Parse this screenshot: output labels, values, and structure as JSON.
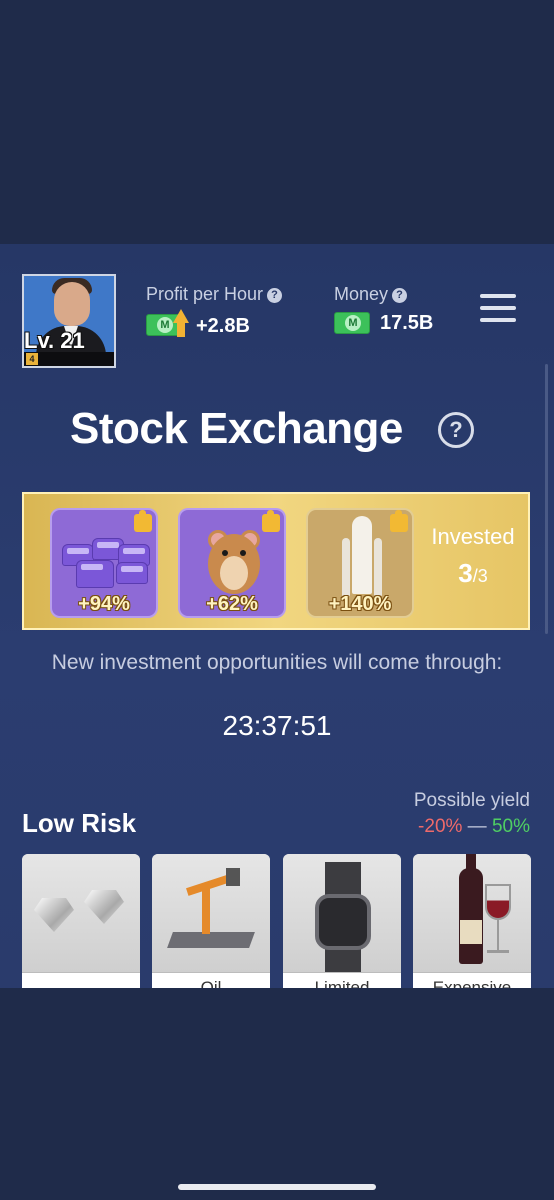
{
  "header": {
    "level": "Lv. 21",
    "level_badge": "4",
    "profit_label": "Profit per Hour",
    "profit_value": "+2.8B",
    "money_label": "Money",
    "money_value": "17.5B",
    "help_glyph": "?",
    "money_icon_letter": "M"
  },
  "page": {
    "title": "Stock Exchange",
    "help_glyph": "?"
  },
  "investments": {
    "tiles": [
      {
        "icon": "vans-icon",
        "yield": "+94%"
      },
      {
        "icon": "hamster-icon",
        "yield": "+62%"
      },
      {
        "icon": "space-shuttle-icon",
        "yield": "+140%"
      }
    ],
    "invested_label": "Invested",
    "invested_count": "3",
    "invested_total": "/3",
    "panel_color": "#e6c565",
    "tile_color": "#8e6ad6"
  },
  "notice": {
    "text": "New investment opportunities will come through:",
    "timer": "23:37:51"
  },
  "low_risk": {
    "title": "Low Risk",
    "yield_label": "Possible yield",
    "yield_low": "-20%",
    "yield_sep": " — ",
    "yield_high": "50%",
    "assets": [
      {
        "icon": "diamonds-icon",
        "name": ""
      },
      {
        "icon": "oil-pump-icon",
        "name": "Oil"
      },
      {
        "icon": "watch-icon",
        "name": "Limited"
      },
      {
        "icon": "wine-icon",
        "name": "Expensive"
      }
    ]
  }
}
